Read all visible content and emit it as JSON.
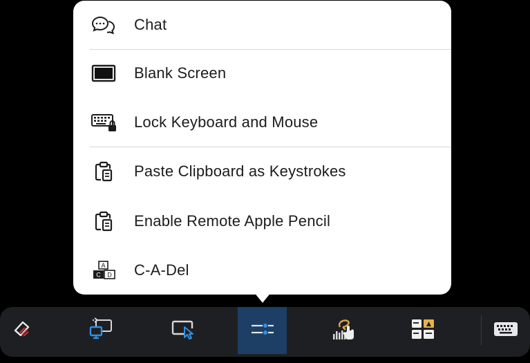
{
  "menu": {
    "items": [
      {
        "label": "Chat",
        "icon": "chat-bubbles-icon"
      },
      {
        "label": "Blank Screen",
        "icon": "blank-screen-icon"
      },
      {
        "label": "Lock Keyboard and Mouse",
        "icon": "lock-keyboard-icon"
      },
      {
        "label": "Paste Clipboard as Keystrokes",
        "icon": "clipboard-icon"
      },
      {
        "label": "Enable Remote Apple Pencil",
        "icon": "clipboard-icon"
      },
      {
        "label": "C-A-Del",
        "icon": "ctrl-alt-del-keys-icon"
      }
    ],
    "cad_keys": {
      "top": "A",
      "left": "C",
      "right": "D"
    }
  },
  "toolbar": {
    "buttons": [
      {
        "icon": "pen-eraser-icon",
        "active": false
      },
      {
        "icon": "switch-monitor-icon",
        "active": false
      },
      {
        "icon": "pointer-mode-icon",
        "active": false
      },
      {
        "icon": "settings-sliders-icon",
        "active": true
      },
      {
        "icon": "gestures-icon",
        "active": false
      },
      {
        "icon": "app-grid-icon",
        "active": false
      },
      {
        "icon": "keyboard-icon",
        "active": false
      }
    ]
  },
  "colors": {
    "background": "#000000",
    "popover": "#ffffff",
    "toolbar": "#1e1f22",
    "active_tab": "#1d3f66",
    "accent": "#2f8fe6",
    "text": "#1c1c1e"
  }
}
